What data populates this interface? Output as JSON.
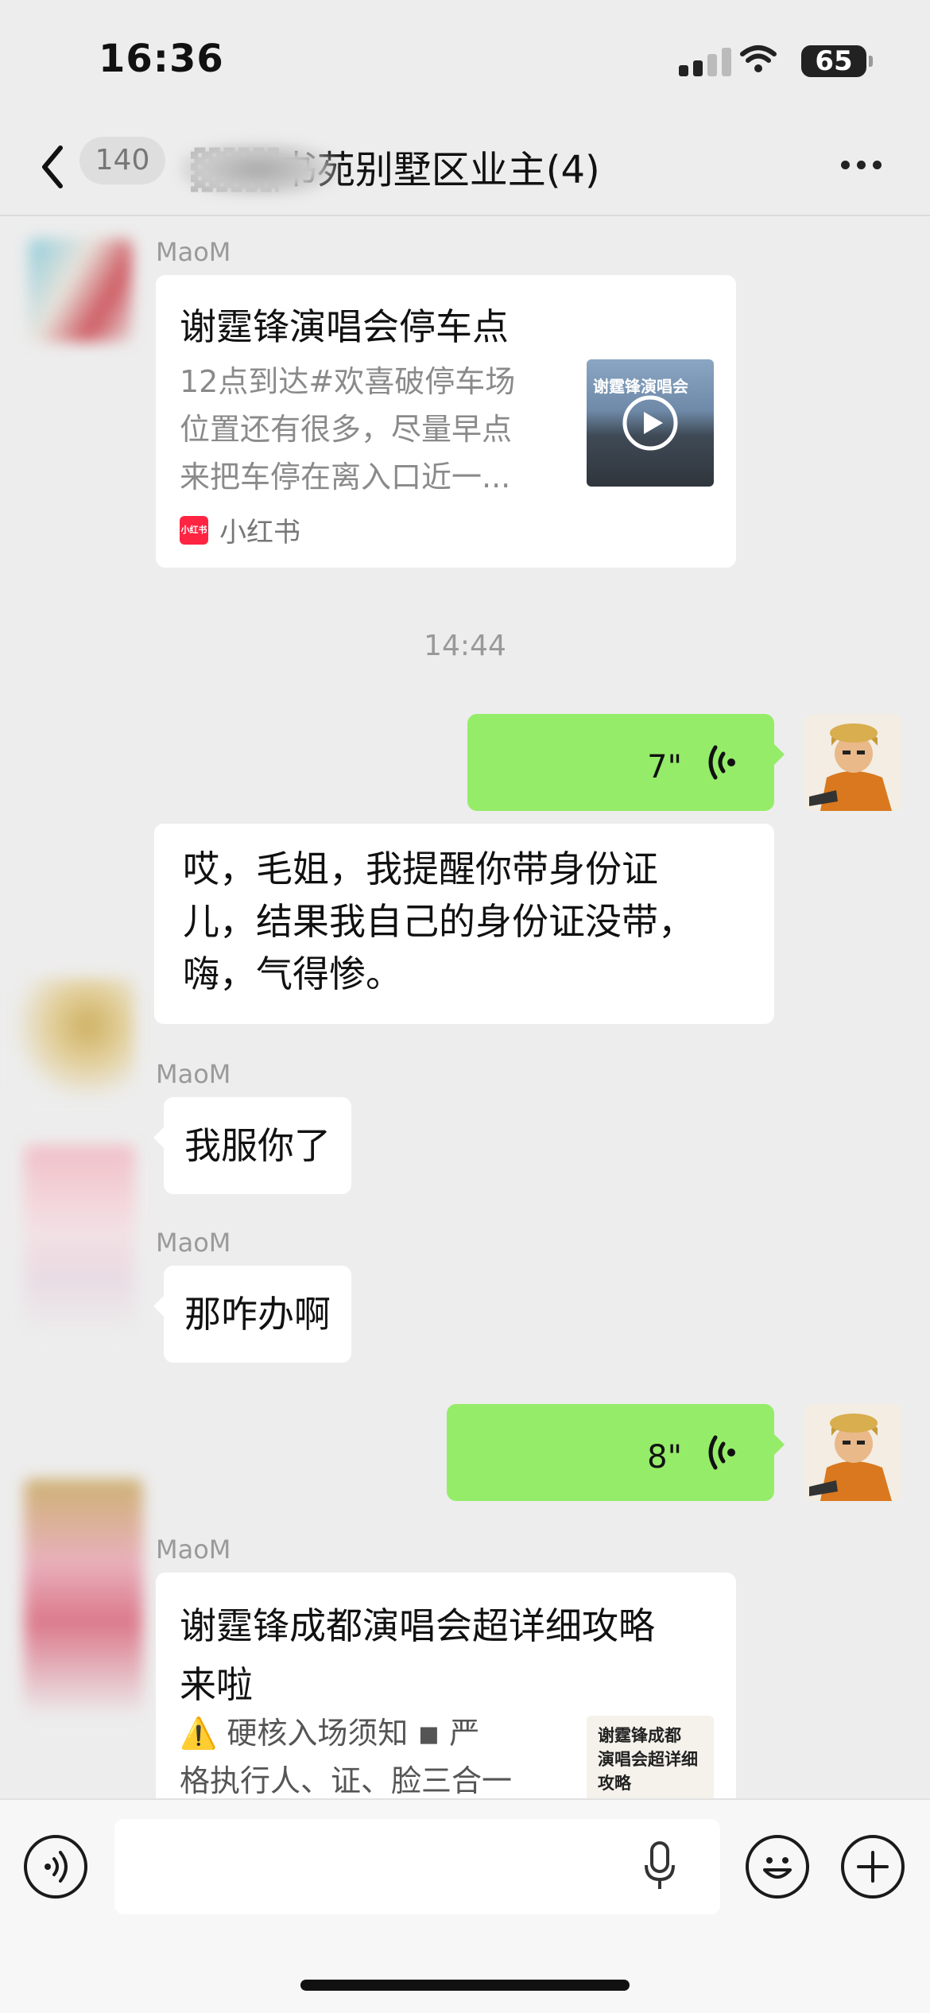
{
  "status_bar": {
    "time": "16:36",
    "battery": "65"
  },
  "nav": {
    "unread_badge": "140",
    "chat_title": "书苑别墅区业主(4)"
  },
  "messages": {
    "card1": {
      "sender": "MaoM",
      "title": "谢霆锋演唱会停车点",
      "desc_lines": [
        "12点到达#欢喜破停车场",
        "位置还有很多，尽量早点",
        "来把车停在离入口近一..."
      ],
      "thumb_text": "谢霆锋演唱会",
      "source": "小红书",
      "source_logo": "小红书"
    },
    "timestamp": "14:44",
    "voice1": {
      "duration": "7\""
    },
    "msg_long": {
      "lines": [
        "哎，毛姐，我提醒你带身份证",
        "儿，结果我自己的身份证没带，",
        "嗨，气得惨。"
      ]
    },
    "msg2": {
      "sender": "MaoM",
      "text": "我服你了"
    },
    "msg3": {
      "sender": "MaoM",
      "text": "那咋办啊"
    },
    "voice2": {
      "duration": "8\""
    },
    "card2": {
      "sender": "MaoM",
      "title_lines": [
        "谢霆锋成都演唱会超详细攻略",
        "来啦"
      ],
      "desc_lines": [
        "⚠️ 硬核入场须知 ◾ 严",
        "格执行人、证、脸三合一"
      ],
      "thumb_lines": [
        "谢霆锋成都",
        "演唱会超详细",
        "攻略"
      ]
    }
  },
  "icons": {
    "back": "chevron-left-icon",
    "more": "more-dots-icon",
    "voice_toggle": "voice-mode-icon",
    "mic": "microphone-icon",
    "emoji": "emoji-icon",
    "plus": "plus-icon"
  },
  "colors": {
    "my_bubble": "#95ec69",
    "background": "#ededed",
    "source_brand": "#ff2442"
  }
}
